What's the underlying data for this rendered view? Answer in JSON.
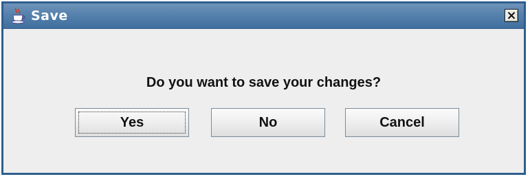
{
  "window": {
    "title": "Save",
    "icon": "java-coffee-cup-icon",
    "close_icon": "close-x-icon",
    "border_color": "#2f5e8e",
    "titlebar_color": "#5581ad"
  },
  "dialog": {
    "message": "Do you want to save your changes?",
    "buttons": {
      "yes": "Yes",
      "no": "No",
      "cancel": "Cancel"
    },
    "focused_button": "Yes"
  }
}
